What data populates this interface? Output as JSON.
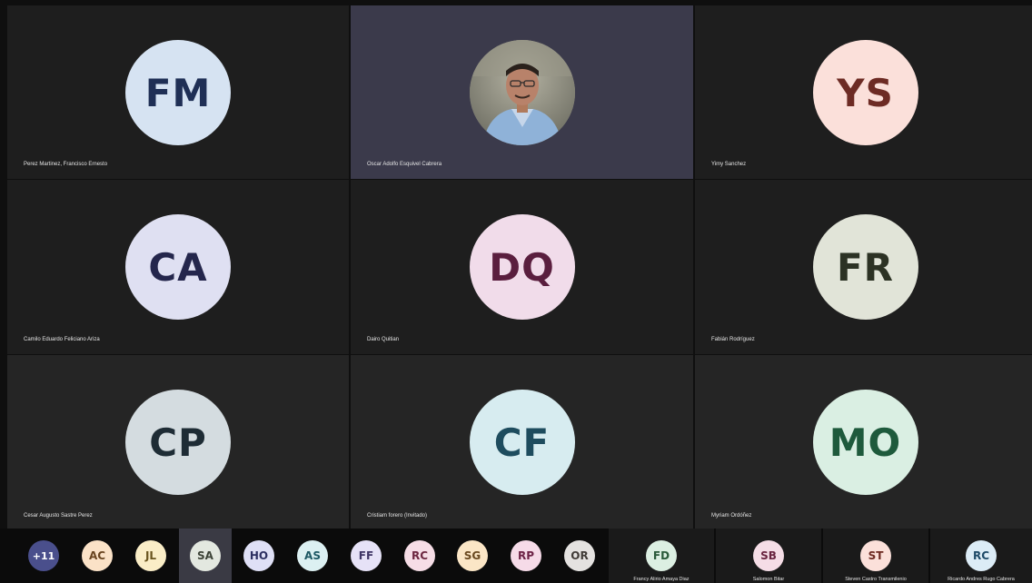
{
  "tiles": [
    {
      "initials": "FM",
      "name": "Perez Martinez, Francisco Ernesto",
      "bg": "#d6e3f2",
      "fg": "#1f2f55"
    },
    {
      "initials": "",
      "name": "Oscar Adolfo Esquivel Cabrera",
      "bg": "#8b8b7b",
      "fg": "#ffffff"
    },
    {
      "initials": "YS",
      "name": "Yimy Sanchez",
      "bg": "#fbe0da",
      "fg": "#6d2b24"
    },
    {
      "initials": "CA",
      "name": "Camilo Eduardo Feliciano Ariza",
      "bg": "#dfe0f2",
      "fg": "#24264c"
    },
    {
      "initials": "DQ",
      "name": "Dairo Quitian",
      "bg": "#f1dcea",
      "fg": "#5a1e3e"
    },
    {
      "initials": "FR",
      "name": "Fabián Rodríguez",
      "bg": "#e1e4d8",
      "fg": "#2c3224"
    },
    {
      "initials": "CP",
      "name": "Cesar Augusto Sastre Perez",
      "bg": "#d4dce0",
      "fg": "#1e2c35"
    },
    {
      "initials": "CF",
      "name": "Cristiam forero (Invitado)",
      "bg": "#d7ecf0",
      "fg": "#1e4c5e"
    },
    {
      "initials": "MO",
      "name": "Myriam Ordóñez",
      "bg": "#daefe3",
      "fg": "#1e5a3c"
    }
  ],
  "strip": {
    "more_label": "+11",
    "avatars": [
      {
        "initials": "AC",
        "bg": "#fbe2c7",
        "fg": "#6a4520"
      },
      {
        "initials": "JL",
        "bg": "#faedc7",
        "fg": "#6a5520"
      },
      {
        "initials": "SA",
        "bg": "#e3e8e0",
        "fg": "#3d4438"
      },
      {
        "initials": "HO",
        "bg": "#dfe0f6",
        "fg": "#2d3062"
      },
      {
        "initials": "AS",
        "bg": "#dcf0f2",
        "fg": "#1e5864"
      },
      {
        "initials": "FF",
        "bg": "#e6e2f7",
        "fg": "#3f3566"
      },
      {
        "initials": "RC",
        "bg": "#f6dde6",
        "fg": "#6e2741"
      },
      {
        "initials": "SG",
        "bg": "#fbe6c6",
        "fg": "#6a4920"
      },
      {
        "initials": "RP",
        "bg": "#f6dbe8",
        "fg": "#6e2447"
      },
      {
        "initials": "OR",
        "bg": "#e4e2e0",
        "fg": "#413c38"
      }
    ],
    "named": [
      {
        "initials": "FD",
        "name": "Francy Alirio Amaya Diaz",
        "bg": "#dcefe2",
        "fg": "#2a5a3a"
      },
      {
        "initials": "SB",
        "name": "Salomon Bitar",
        "bg": "#f5dde6",
        "fg": "#6a2440"
      },
      {
        "initials": "ST",
        "name": "Steven Castro Transmilenio",
        "bg": "#fbe0da",
        "fg": "#6e2a22"
      },
      {
        "initials": "RC",
        "name": "Ricardo Andres Rugo Cabrera",
        "bg": "#dcecf6",
        "fg": "#1e4a68"
      }
    ]
  }
}
